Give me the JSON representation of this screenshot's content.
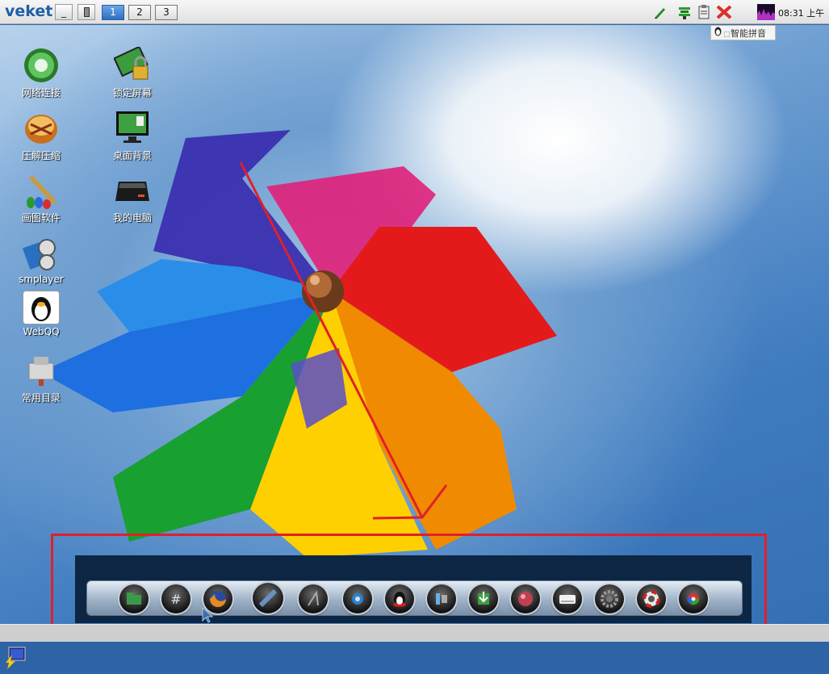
{
  "top_panel": {
    "logo": "veket",
    "minimize_label": "_",
    "workspaces": [
      "1",
      "2",
      "3"
    ],
    "active_workspace": "1",
    "tray_icons": [
      "pencil-icon",
      "stack-icon",
      "clipboard-icon",
      "close-x-icon",
      "cpu-monitor-icon"
    ],
    "clock": "08:31 上午"
  },
  "ime": {
    "label": "智能拼音"
  },
  "desktop_icons": [
    {
      "label": "网络连接",
      "icon": "network-globe-icon"
    },
    {
      "label": "锁定屏幕",
      "icon": "lock-screen-icon"
    },
    {
      "label": "压解压缩",
      "icon": "archive-icon"
    },
    {
      "label": "桌面背景",
      "icon": "desktop-background-icon"
    },
    {
      "label": "画图软件",
      "icon": "paint-brush-icon"
    },
    {
      "label": "我的电脑",
      "icon": "computer-drive-icon"
    },
    {
      "label": "smplayer",
      "icon": "media-player-icon"
    },
    {
      "label": "WebQQ",
      "icon": "penguin-icon"
    },
    {
      "label": "常用目录",
      "icon": "folder-tools-icon"
    }
  ],
  "dock": {
    "items": [
      "file-manager-icon",
      "terminal-icon",
      "firefox-icon",
      "editor-icon",
      "music-icon",
      "settings-icon",
      "qq-icon",
      "media-icon",
      "install-icon",
      "paint-icon",
      "drive-icon",
      "gear-icon",
      "help-icon",
      "color-icon"
    ]
  },
  "colors": {
    "annotation": "#e0202a",
    "accent": "#1f5ea8"
  }
}
